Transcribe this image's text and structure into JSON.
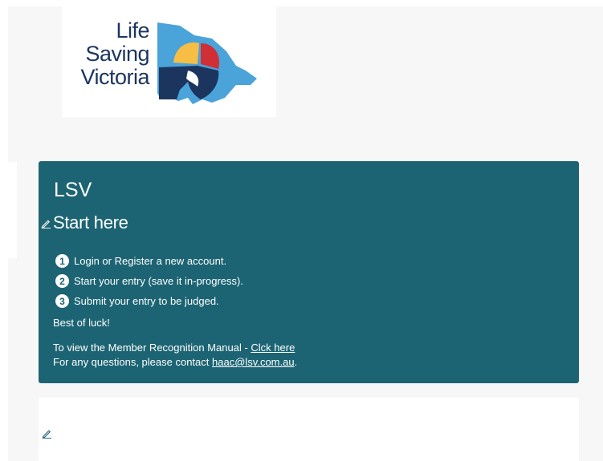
{
  "logo": {
    "lines": [
      "Life",
      "Saving",
      "Victoria"
    ],
    "colors": {
      "navy": "#1b355e",
      "blue": "#4aa3d9",
      "yellow": "#f6be45",
      "red": "#d12f36"
    }
  },
  "panel": {
    "title": "LSV",
    "heading": "Start here",
    "steps": [
      {
        "num": "1",
        "text": "Login or Register a new account."
      },
      {
        "num": "2",
        "text": "Start your entry (save it in-progress)."
      },
      {
        "num": "3",
        "text": "Submit your entry to be judged."
      }
    ],
    "luck": "Best of luck!",
    "manual_prefix": "To view the Member Recognition Manual - ",
    "manual_link": "Clck here",
    "contact_prefix": "For any questions, please contact ",
    "contact_email": "haac@lsv.com.au",
    "contact_suffix": ".",
    "bg_color": "#1c6473"
  },
  "icons": {
    "edit": "pencil-icon"
  }
}
